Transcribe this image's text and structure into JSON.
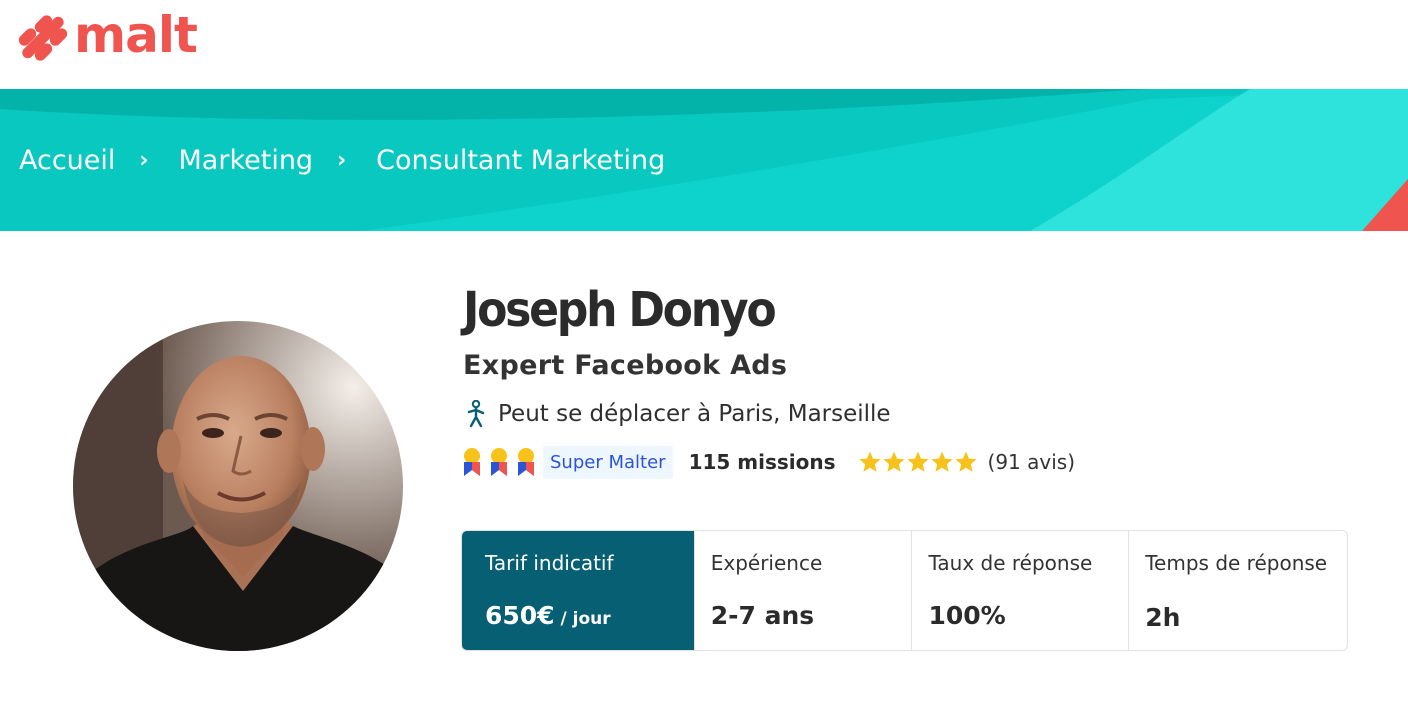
{
  "header": {
    "logo_text": "malt",
    "brand_color": "#f0544f"
  },
  "breadcrumb": {
    "items": [
      {
        "label": "Accueil"
      },
      {
        "label": "Marketing"
      },
      {
        "label": "Consultant Marketing"
      }
    ],
    "separator": "›",
    "banner_color": "#03b3aa"
  },
  "profile": {
    "name": "Joseph Donyo",
    "headline": "Expert Facebook Ads",
    "location": "Peut se déplacer à Paris, Marseille",
    "badge_label": "Super Malter",
    "missions": "115 missions",
    "rating_stars": 5,
    "reviews": "(91 avis)",
    "avatar_icon": "profile-photo"
  },
  "stats": {
    "rate_label": "Tarif indicatif",
    "rate_value": "650€",
    "rate_unit": " / jour",
    "experience_label": "Expérience",
    "experience_value": "2-7 ans",
    "response_rate_label": "Taux de réponse",
    "response_rate_value": "100%",
    "response_time_label": "Temps de réponse",
    "response_time_value": "2h",
    "accent_color": "#075f73"
  }
}
